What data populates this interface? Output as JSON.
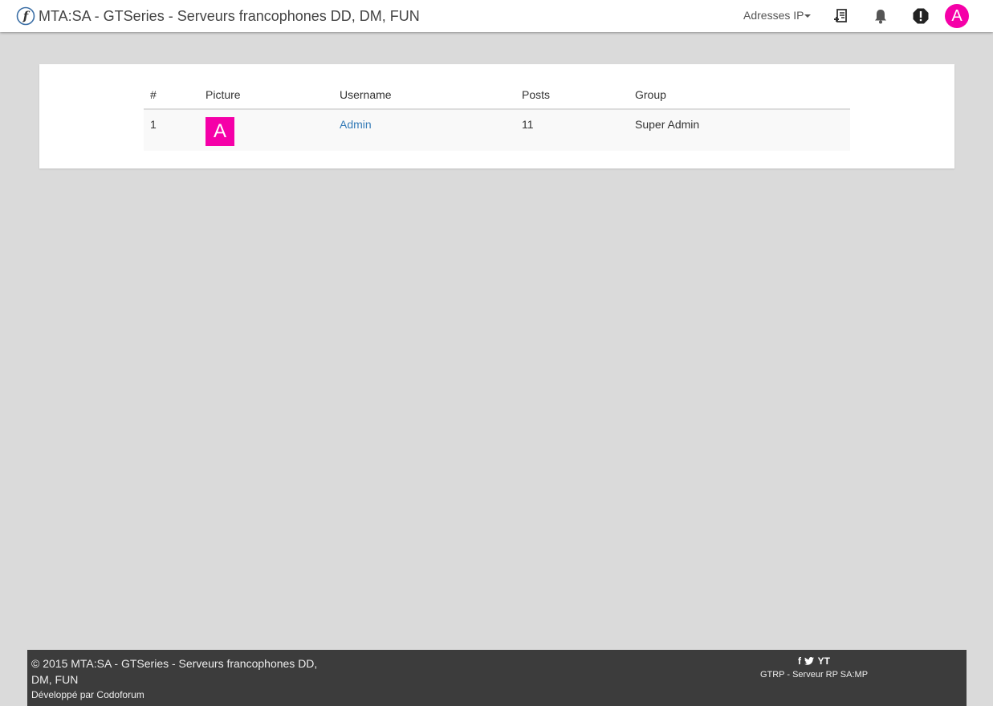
{
  "header": {
    "site_title": "MTA:SA - GTSeries - Serveurs francophones DD, DM, FUN",
    "ip_menu_label": "Adresses IP",
    "avatar_letter": "A",
    "avatar_color": "#f500a8",
    "icons": [
      "new-post-icon",
      "bell-icon",
      "alert-icon"
    ]
  },
  "users_table": {
    "columns": {
      "num": "#",
      "picture": "Picture",
      "username": "Username",
      "posts": "Posts",
      "group": "Group"
    },
    "rows": [
      {
        "num": "1",
        "picture_letter": "A",
        "username": "Admin",
        "posts": "11",
        "group": "Super Admin"
      }
    ]
  },
  "footer": {
    "copyright": "© 2015 MTA:SA - GTSeries - Serveurs francophones DD, DM, FUN",
    "developed_by_prefix": "Développé par",
    "developed_by_link": "Codoforum",
    "social": {
      "facebook": "f",
      "youtube": "YT"
    },
    "right_link": "GTRP - Serveur RP SA:MP"
  },
  "colors": {
    "accent_pink": "#f500a8",
    "link_blue": "#337ab7",
    "footer_bg": "#3c3c3c",
    "page_bg": "#dadada"
  }
}
